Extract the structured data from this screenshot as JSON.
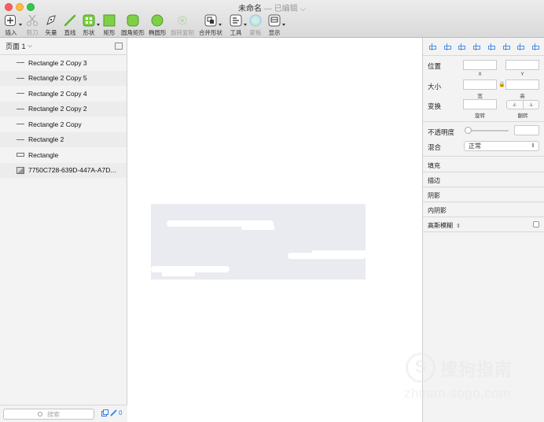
{
  "window": {
    "title": "未命名",
    "edited_label": "— 已编辑"
  },
  "toolbar": {
    "insert": "插入",
    "scissors": "剪刀",
    "vector": "矢量",
    "line": "直线",
    "shape": "形状",
    "rectangle": "矩形",
    "rounded_rect": "圆角矩形",
    "oval": "椭圆形",
    "rotate_copy": "旋转复制",
    "combine": "合并形状",
    "tools": "工具",
    "mask": "蒙板",
    "view": "显示"
  },
  "sidebar": {
    "page_selector": "页面 1",
    "layers": [
      {
        "name": "Rectangle 2 Copy 3",
        "icon": "line-icon"
      },
      {
        "name": "Rectangle 2 Copy 5",
        "icon": "line-icon"
      },
      {
        "name": "Rectangle 2 Copy 4",
        "icon": "line-icon"
      },
      {
        "name": "Rectangle 2 Copy 2",
        "icon": "line-icon"
      },
      {
        "name": "Rectangle 2 Copy",
        "icon": "line-icon"
      },
      {
        "name": "Rectangle 2",
        "icon": "line-icon"
      },
      {
        "name": "Rectangle",
        "icon": "rectangle-icon"
      },
      {
        "name": "7750C728-639D-447A-A7D...",
        "icon": "image-icon"
      }
    ],
    "search_placeholder": "搜索",
    "slice_count": "0"
  },
  "inspector": {
    "position": "位置",
    "x": "X",
    "y": "Y",
    "size": "大小",
    "width": "宽",
    "height": "高",
    "transform": "变换",
    "rotate": "旋转",
    "flip": "翻转",
    "opacity": "不透明度",
    "blend": "混合",
    "blend_value": "正常",
    "fill": "填充",
    "border": "描边",
    "shadow": "阴影",
    "inner_shadow": "内阴影",
    "gaussian_blur": "高斯模糊"
  },
  "watermark": {
    "text": "搜狗指南",
    "url": "zhinan.sogo.com"
  }
}
